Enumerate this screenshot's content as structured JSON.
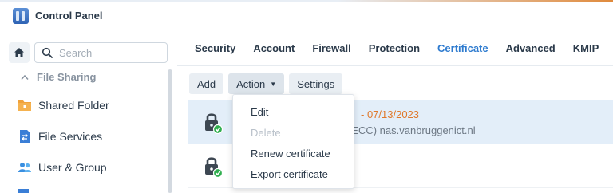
{
  "app": {
    "title": "Control Panel"
  },
  "colors": {
    "accent": "#2e7bcf",
    "warning": "#e0782a",
    "ok": "#2fae4e"
  },
  "sidebar": {
    "search_placeholder": "Search",
    "section": "File Sharing",
    "items": [
      {
        "label": "Shared Folder",
        "icon": "shared-folder-icon"
      },
      {
        "label": "File Services",
        "icon": "file-services-icon"
      },
      {
        "label": "User & Group",
        "icon": "user-group-icon"
      }
    ]
  },
  "tabs": [
    {
      "label": "Security",
      "active": false
    },
    {
      "label": "Account",
      "active": false
    },
    {
      "label": "Firewall",
      "active": false
    },
    {
      "label": "Protection",
      "active": false
    },
    {
      "label": "Certificate",
      "active": true
    },
    {
      "label": "Advanced",
      "active": false
    },
    {
      "label": "KMIP",
      "active": false
    }
  ],
  "toolbar": {
    "add": "Add",
    "action": "Action",
    "settings": "Settings"
  },
  "certificates": [
    {
      "expiry_fragment": "- 07/13/2023",
      "detail_fragment": "A/ECC) nas.vanbruggenict.nl",
      "status_icon": "lock-verified-icon"
    },
    {
      "status_icon": "lock-verified-icon"
    }
  ],
  "action_menu": {
    "items": [
      {
        "label": "Edit",
        "enabled": true
      },
      {
        "label": "Delete",
        "enabled": false
      },
      {
        "label": "Renew certificate",
        "enabled": true
      },
      {
        "label": "Export certificate",
        "enabled": true
      }
    ]
  }
}
